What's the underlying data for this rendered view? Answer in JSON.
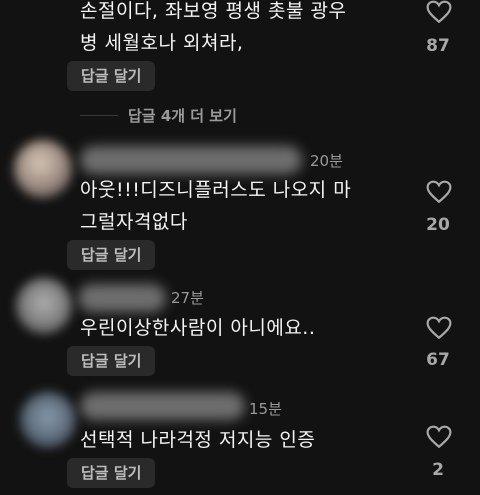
{
  "reply_label": "답글 달기",
  "comments": [
    {
      "text_lines": [
        "손절이다, 좌보영 평생 촛불 광우",
        "병 세월호나 외쳐라,"
      ],
      "likes": "87"
    },
    {
      "time": "20분",
      "text_lines": [
        "아웃!!!디즈니플러스도 나오지 마",
        "그럴자격없다"
      ],
      "likes": "20"
    },
    {
      "time": "27분",
      "text_lines": [
        "우린이상한사람이 아니에요.."
      ],
      "likes": "67"
    },
    {
      "time": "15분",
      "text_lines": [
        "선택적 나라걱정 저지능 인증"
      ],
      "likes": "2"
    }
  ],
  "see_replies": "답글 4개 더 보기",
  "colors": {
    "background": "#121212",
    "button_bg": "#2a2a2a",
    "muted": "#9a9a9a"
  }
}
